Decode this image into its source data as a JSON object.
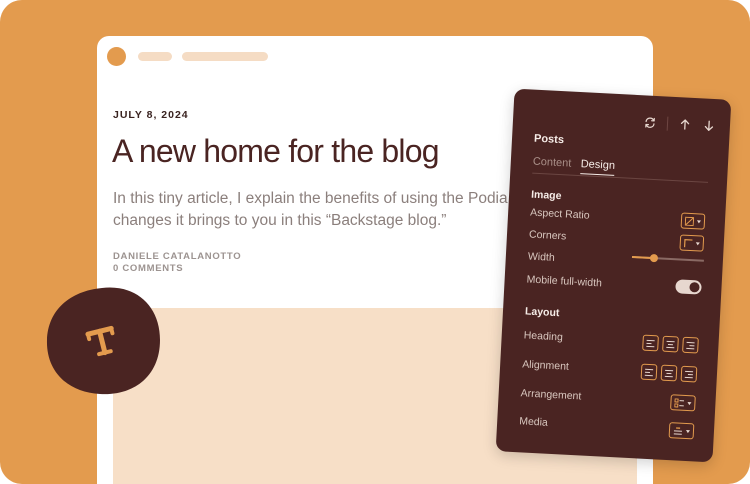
{
  "post": {
    "date": "JULY 8, 2024",
    "title": "A new home for the blog",
    "excerpt_line1": "In this tiny article, I explain the benefits of using the Podia blog and the",
    "excerpt_line2": "changes it brings to you in this “Backstage blog.”",
    "author": "DANIELE CATALANOTTO",
    "comments": "0 COMMENTS"
  },
  "badge": {
    "letter": "T"
  },
  "panel": {
    "heading": "Posts",
    "tabs": [
      {
        "label": "Content",
        "active": false
      },
      {
        "label": "Design",
        "active": true
      }
    ],
    "image_section": "Image",
    "aspect_ratio_label": "Aspect Ratio",
    "corners_label": "Corners",
    "width_label": "Width",
    "width_value": 0.3,
    "mobile_full_width_label": "Mobile full-width",
    "mobile_full_width_on": true,
    "layout_section": "Layout",
    "heading_label": "Heading",
    "alignment_label": "Alignment",
    "arrangement_label": "Arrangement",
    "media_label": "Media"
  },
  "colors": {
    "background": "#e39b4e",
    "panel": "#4a2422",
    "accent": "#e39b4e",
    "title": "#4a2422",
    "media_placeholder": "#f7dfc7"
  }
}
